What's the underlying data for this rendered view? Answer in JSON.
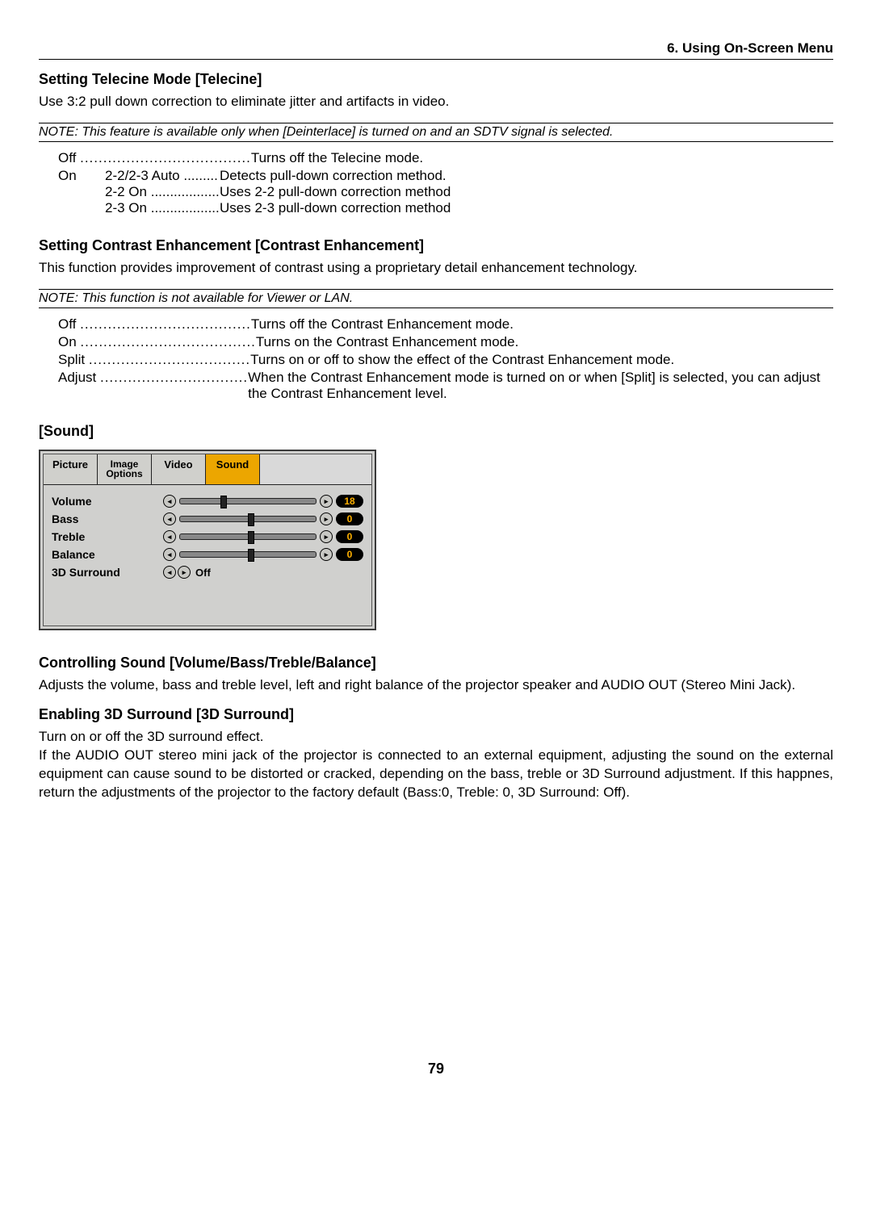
{
  "chapter": "6. Using On-Screen Menu",
  "telecine": {
    "title": "Setting Telecine Mode [Telecine]",
    "desc": "Use 3:2 pull down correction to eliminate jitter and artifacts in video.",
    "note": "NOTE: This feature is available only when [Deinterlace] is turned on and an SDTV signal is selected.",
    "off_label": "Off",
    "off_dots": ".....................................",
    "off_desc": "Turns off the Telecine mode.",
    "on_label": "On",
    "rows": [
      {
        "sub": "2-2/2-3 Auto",
        "dots": ".........",
        "desc": "Detects pull-down correction method."
      },
      {
        "sub": "2-2 On",
        "dots": "..................",
        "desc": "Uses 2-2 pull-down correction method"
      },
      {
        "sub": "2-3 On",
        "dots": "..................",
        "desc": "Uses 2-3 pull-down correction method"
      }
    ]
  },
  "contrast": {
    "title": "Setting Contrast Enhancement [Contrast Enhancement]",
    "desc": "This function provides improvement of contrast using a proprietary detail enhancement technology.",
    "note": "NOTE: This function is not available for Viewer or LAN.",
    "rows": [
      {
        "term": "Off",
        "dots": ".....................................",
        "desc": "Turns off the Contrast Enhancement mode."
      },
      {
        "term": "On",
        "dots": "......................................",
        "desc": "Turns on the Contrast Enhancement mode."
      },
      {
        "term": "Split",
        "dots": "...................................",
        "desc": "Turns on or off to show the effect of the Contrast Enhancement mode."
      },
      {
        "term": "Adjust",
        "dots": "................................",
        "desc": "When the Contrast Enhancement mode is turned on or when [Split] is selected, you can adjust the Contrast Enhancement level."
      }
    ]
  },
  "sound": {
    "head": "[Sound]",
    "tabs": {
      "picture": "Picture",
      "image": "Image\nOptions",
      "video": "Video",
      "sound": "Sound"
    },
    "rows": [
      {
        "label": "Volume",
        "val": "18",
        "pos": 30
      },
      {
        "label": "Bass",
        "val": "0",
        "pos": 50
      },
      {
        "label": "Treble",
        "val": "0",
        "pos": 50
      },
      {
        "label": "Balance",
        "val": "0",
        "pos": 50
      }
    ],
    "surround": {
      "label": "3D Surround",
      "val": "Off"
    }
  },
  "ctrlSound": {
    "title": "Controlling Sound [Volume/Bass/Treble/Balance]",
    "desc": "Adjusts the volume, bass and treble level, left and right balance of the projector speaker and AUDIO OUT (Stereo Mini Jack)."
  },
  "surround": {
    "title": "Enabling 3D Surround [3D Surround]",
    "l1": "Turn on or off the 3D surround effect.",
    "l2": "If the AUDIO OUT stereo mini jack of the projector is connected to an external equipment, adjusting the sound on the external equipment can cause sound to be distorted or cracked, depending on the bass, treble or 3D Surround adjustment. If this happnes, return the adjustments of the projector to the factory default (Bass:0, Treble: 0, 3D Surround: Off)."
  },
  "pagenum": "79"
}
